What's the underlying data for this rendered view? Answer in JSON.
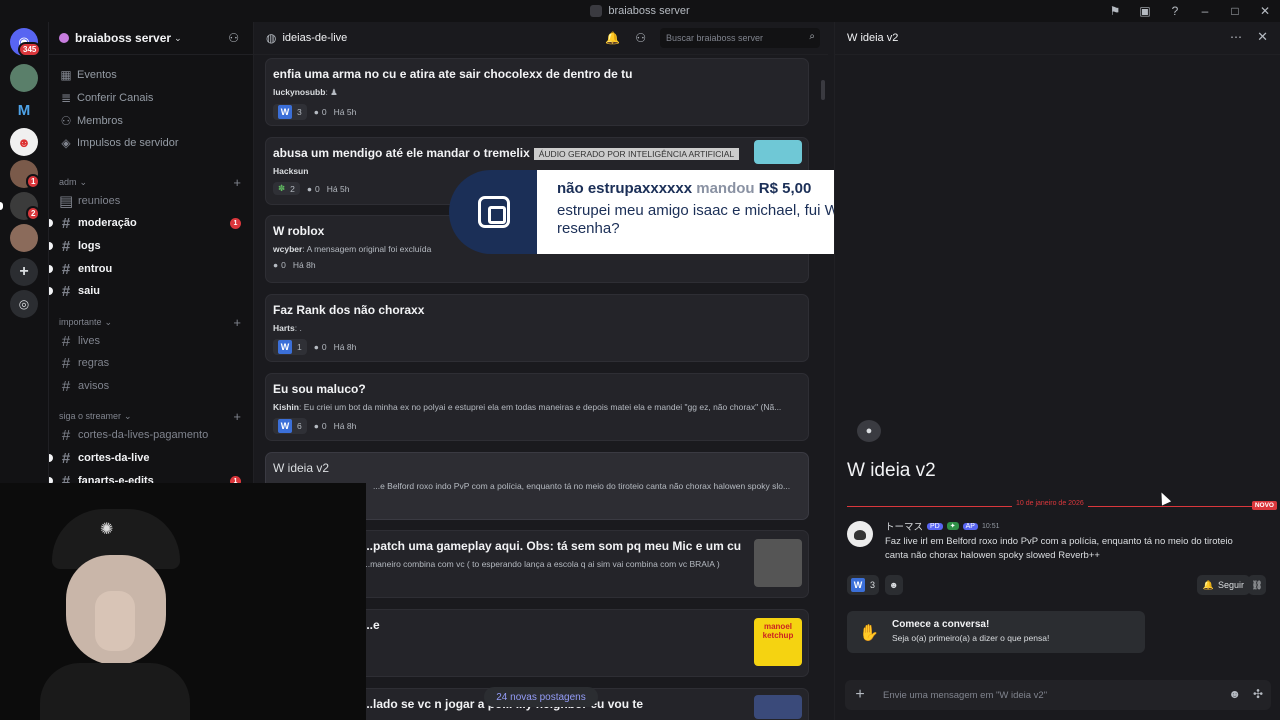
{
  "window": {
    "title": "braiaboss server"
  },
  "rail": {
    "dm_badge": "345",
    "servers": [
      {
        "name": "server-1",
        "badge": ""
      },
      {
        "name": "server-2",
        "label": "M",
        "badge": ""
      },
      {
        "name": "server-3",
        "badge": ""
      },
      {
        "name": "server-4",
        "badge": "1"
      },
      {
        "name": "server-5",
        "badge": "2"
      },
      {
        "name": "server-6",
        "badge": ""
      }
    ]
  },
  "sidebar": {
    "server_name": "braiaboss server",
    "top_items": [
      {
        "label": "Eventos",
        "icon": "calendar-icon"
      },
      {
        "label": "Conferir Canais",
        "icon": "channels-icon"
      },
      {
        "label": "Membros",
        "icon": "members-icon"
      },
      {
        "label": "Impulsos de servidor",
        "icon": "boost-icon"
      }
    ],
    "categories": [
      {
        "label": "adm",
        "channels": [
          {
            "label": "reunioes",
            "unread": false,
            "mention": ""
          },
          {
            "label": "moderação",
            "unread": true,
            "mention": "1"
          },
          {
            "label": "logs",
            "unread": true,
            "mention": ""
          },
          {
            "label": "entrou",
            "unread": true,
            "mention": ""
          },
          {
            "label": "saiu",
            "unread": true,
            "mention": ""
          }
        ]
      },
      {
        "label": "importante",
        "channels": [
          {
            "label": "lives",
            "unread": false,
            "mention": ""
          },
          {
            "label": "regras",
            "unread": false,
            "mention": ""
          },
          {
            "label": "avisos",
            "unread": false,
            "mention": ""
          }
        ]
      },
      {
        "label": "siga o streamer",
        "channels": [
          {
            "label": "cortes-da-lives-pagamento",
            "unread": false,
            "mention": ""
          },
          {
            "label": "cortes-da-live",
            "unread": true,
            "mention": ""
          },
          {
            "label": "fanarts-e-edits",
            "unread": true,
            "mention": "1"
          }
        ]
      }
    ]
  },
  "forum": {
    "channel_name": "ideias-de-live",
    "search_placeholder": "Buscar braiaboss server",
    "posts": [
      {
        "title": "enfia uma arma no cu e atira ate sair chocolexx de dentro de tu",
        "author": "luckynosubb",
        "preview": "",
        "reaction": "3",
        "comments": "0",
        "time": "Há 5h"
      },
      {
        "title": "abusa um mendigo até ele mandar o tremelix",
        "tag": "ÁUDIO GERADO POR INTELIGÊNCIA ARTIFICIAL",
        "author": "Hacksun",
        "preview": "",
        "reaction": "2",
        "comments": "0",
        "time": "Há 5h"
      },
      {
        "title": "W roblox",
        "author": "wcyber",
        "preview": "A mensagem original foi excluída",
        "reaction": "",
        "comments": "0",
        "time": "Há 8h"
      },
      {
        "title": "Faz Rank dos não choraxx",
        "author": "Harts",
        "preview": ".",
        "reaction": "1",
        "comments": "0",
        "time": "Há 8h"
      },
      {
        "title": "Eu sou maluco?",
        "author": "Kishin",
        "preview": "Eu criei um bot da minha ex no polyai e estuprei ela em todas maneiras e depois matei ela e mandei \"gg ez, não chorax\" (Nã...",
        "reaction": "6",
        "comments": "0",
        "time": "Há 8h"
      },
      {
        "title": "W ideia v2",
        "author": "",
        "preview": "...e Belford roxo indo PvP com a polícia, enquanto tá no meio do tiroteio canta não chorax halowen spoky slo...",
        "reaction": "",
        "comments": "",
        "time": "Há 8h"
      },
      {
        "title": "...patch uma gameplay aqui. Obs: tá sem som pq meu Mic e um cu",
        "author": "",
        "preview": "...maneiro combina com vc ( to esperando lança a escola q ai sim vai combina com vc BRAIA )",
        "reaction": "",
        "comments": "",
        "time": ""
      },
      {
        "title": "...e",
        "author": "",
        "preview": "",
        "reaction": "",
        "comments": "",
        "time": "",
        "thumb_text": "manoel ketchup"
      },
      {
        "title": "...lado se vc n jogar a po... ...y neighbor eu vou te",
        "author": "",
        "preview": "",
        "reaction": "",
        "comments": "",
        "time": ""
      }
    ],
    "new_posts_label": "24 novas postagens"
  },
  "donation": {
    "donor": "não estrupaxxxxxx",
    "verb": "mandou",
    "amount": "R$ 5,00",
    "message": "estrupei meu amigo isaac e michael, fui W resenha?"
  },
  "thread": {
    "header_title": "W ideia v2",
    "title": "W ideia v2",
    "date_divider": "10 de janeiro de 2026",
    "new_label": "NOVO",
    "message": {
      "author": "トーマス",
      "tag1": "PD",
      "tag2": "AP",
      "time": "10:51",
      "text": "Faz live irl em Belford roxo indo PvP com a polícia, enquanto tá no meio do tiroteio canta não chorax halowen spoky slowed Reverb++"
    },
    "reaction_count": "3",
    "follow_label": "Seguir",
    "starter_title": "Comece a conversa!",
    "starter_sub": "Seja o(a) primeiro(a) a dizer o que pensa!",
    "composer_placeholder": "Envie uma mensagem em \"W ideia v2\""
  },
  "colors": {
    "accent": "#5865f2",
    "mention": "#da373c",
    "reaction_w": "#3b6fd8"
  }
}
